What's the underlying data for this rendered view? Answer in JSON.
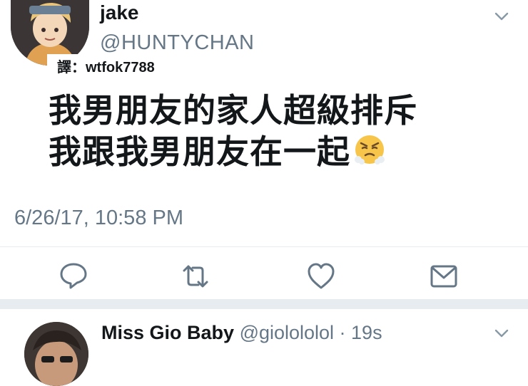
{
  "tweet": {
    "display_name": "jake",
    "handle": "@HUNTYCHAN",
    "translator_credit": "譯：wtfok7788",
    "text_lines": [
      "我男朋友的家人超級排斥",
      "我跟我男朋友在一起"
    ],
    "emoji": "face-with-steam-from-nose",
    "timestamp": "6/26/17, 10:58 PM"
  },
  "actions": [
    {
      "name": "reply",
      "icon": "reply-icon"
    },
    {
      "name": "retweet",
      "icon": "retweet-icon"
    },
    {
      "name": "like",
      "icon": "heart-icon"
    },
    {
      "name": "share",
      "icon": "envelope-icon"
    }
  ],
  "reply": {
    "display_name": "Miss Gio Baby",
    "handle_time": "@giolololol · 19s"
  },
  "colors": {
    "text": "#14171a",
    "secondary": "#657786",
    "divider": "#e6ecf0",
    "icon": "#657786"
  }
}
